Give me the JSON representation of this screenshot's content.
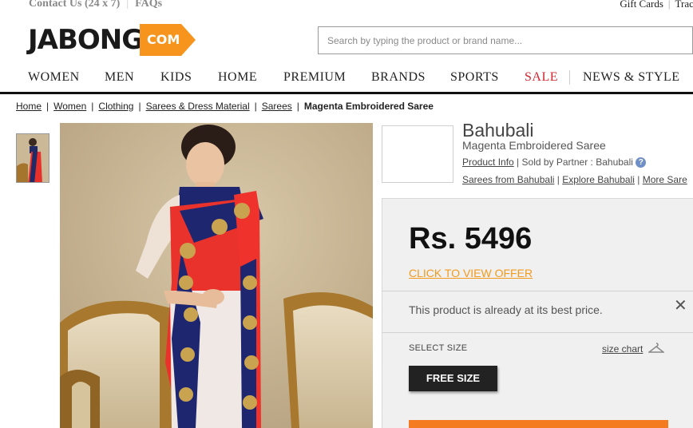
{
  "topbar": {
    "contact": "Contact Us (24 x 7)",
    "divider": "|",
    "faqs": "FAQs",
    "gift_cards": "Gift Cards",
    "track": "Track O"
  },
  "logo": {
    "word": "JABONG",
    "suffix": "COM",
    "accent_color": "#f7941d"
  },
  "search": {
    "placeholder": "Search by typing the product or brand name..."
  },
  "nav": {
    "items": [
      "WOMEN",
      "MEN",
      "KIDS",
      "HOME",
      "PREMIUM",
      "BRANDS",
      "SPORTS",
      "SALE",
      "NEWS & STYLE"
    ],
    "sale_color": "#d0242f"
  },
  "breadcrumb": {
    "items": [
      "Home",
      "Women",
      "Clothing",
      "Sarees & Dress Material",
      "Sarees"
    ],
    "current": "Magenta Embroidered Saree",
    "separator": "|"
  },
  "product": {
    "brand": "Bahubali",
    "name": "Magenta Embroidered Saree",
    "product_info": "Product Info",
    "sold_by": "Sold by Partner : Bahubali",
    "help_icon": "?",
    "links": [
      "Sarees from Bahubali",
      "Explore Bahubali",
      "More Sare"
    ],
    "price": "Rs. 5496",
    "offer": "CLICK TO VIEW OFFER",
    "best_price_note": "This product is already at its best price.",
    "close": "✕",
    "select_size_label": "SELECT SIZE",
    "size_chart": "size chart",
    "size_option": "FREE SIZE",
    "buy_color": "#f47b20"
  }
}
